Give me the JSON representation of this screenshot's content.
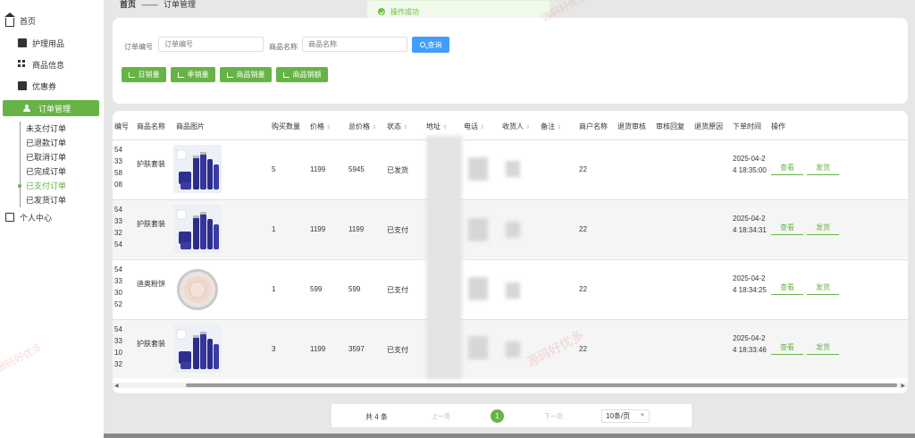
{
  "sidebar": {
    "home": "首页",
    "items": [
      "护理用品",
      "商品信息",
      "优惠券"
    ],
    "active": "订单管理",
    "subitems": [
      "未支付订单",
      "已退款订单",
      "已取消订单",
      "已完成订单",
      "已支付订单",
      "已发货订单"
    ],
    "active_sub_index": 4,
    "personal": "个人中心"
  },
  "breadcrumb": {
    "home": "首页",
    "sep": "——",
    "current": "订单管理"
  },
  "toast": {
    "message": "操作成功"
  },
  "search": {
    "order_label": "订单编号",
    "order_placeholder": "订单编号",
    "product_label": "商品名称",
    "product_placeholder": "商品名称",
    "query_button": "查询"
  },
  "stats_buttons": [
    "日销量",
    "季销量",
    "商品销量",
    "商品销额"
  ],
  "table": {
    "headers": [
      "编号",
      "商品名称",
      "商品图片",
      "购买数量",
      "价格",
      "总价格",
      "状态",
      "地址",
      "电话",
      "收货人",
      "备注",
      "商户名称",
      "退货审核",
      "审核回复",
      "退货原因",
      "下单时间",
      "操作"
    ],
    "rows": [
      {
        "id_lines": [
          "54",
          "33",
          "58",
          "08"
        ],
        "name": "护肤套装",
        "image": "skincare-set",
        "qty": "5",
        "price": "1199",
        "total": "5945",
        "status": "已发货",
        "merchant": "22",
        "time": "2025-04-24 18:35:00"
      },
      {
        "id_lines": [
          "54",
          "33",
          "32",
          "54"
        ],
        "name": "护肤套装",
        "image": "skincare-set",
        "qty": "1",
        "price": "1199",
        "total": "1199",
        "status": "已支付",
        "merchant": "22",
        "time": "2025-04-24 18:34:31"
      },
      {
        "id_lines": [
          "54",
          "33",
          "30",
          "52"
        ],
        "name": "迪奥粉饼",
        "image": "dior-powder",
        "qty": "1",
        "price": "599",
        "total": "599",
        "status": "已支付",
        "merchant": "22",
        "time": "2025-04-24 18:34:25"
      },
      {
        "id_lines": [
          "54",
          "33",
          "10",
          "32"
        ],
        "name": "护肤套装",
        "image": "skincare-set",
        "qty": "3",
        "price": "1199",
        "total": "3597",
        "status": "已支付",
        "merchant": "22",
        "time": "2025-04-24 18:33:46"
      }
    ],
    "view_label": "查看",
    "ship_label": "发货"
  },
  "pagination": {
    "total": "共 4 条",
    "prev": "上一页",
    "current": "1",
    "next": "下一页",
    "page_size": "10条/页"
  },
  "watermark": "源码好优多",
  "colors": {
    "accent": "#67b346",
    "query": "#409eff",
    "toast_bg": "#f0f9eb"
  }
}
